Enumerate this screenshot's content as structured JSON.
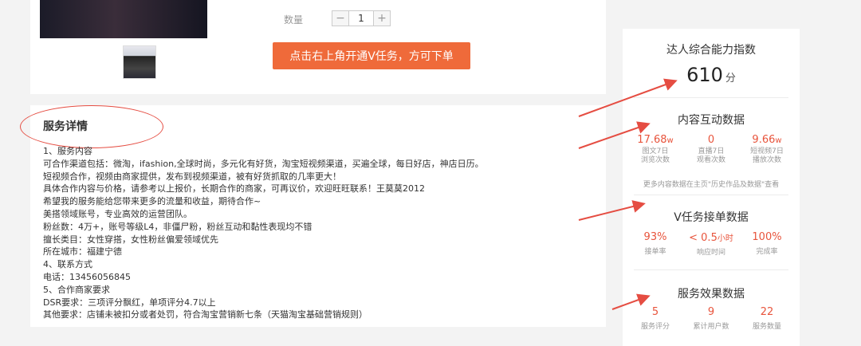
{
  "product": {
    "quantity_label": "数量",
    "quantity_value": "1",
    "minus": "−",
    "plus": "+",
    "cta_label": "点击右上角开通V任务，方可下单"
  },
  "service": {
    "title": "服务详情",
    "lines": [
      "1、服务内容",
      "可合作渠道包括：微淘，ifashion,全球时尚，多元化有好货，淘宝短视频渠道，买遍全球，每日好店，神店日历。",
      "短视频合作，视频由商家提供，发布到视频渠道，被有好货抓取的几率更大！",
      "具体合作内容与价格，请参考以上报价，长期合作的商家，可再议价，欢迎旺旺联系！王莫莫2012",
      "希望我的服务能给您带来更多的流量和收益，期待合作~",
      "美搭领域账号，专业高效的运营团队。",
      "粉丝数：4万+，账号等级L4，非僵尸粉，粉丝互动和黏性表现均不错",
      "擅长类目：女性穿搭，女性粉丝偏爱领域优先",
      "所在城市：福建宁德",
      "4、联系方式",
      "电话：13456056845",
      "5、合作商家要求",
      "DSR要求：三项评分飘红，单项评分4.7以上",
      "其他要求：店铺未被扣分或者处罚，符合淘宝营销新七条（天猫淘宝基础营销规则）"
    ]
  },
  "sidebar": {
    "ability": {
      "title": "达人综合能力指数",
      "score": "610",
      "unit": "分"
    },
    "interaction": {
      "title": "内容互动数据",
      "stats": [
        {
          "value": "17.68",
          "unit": "w",
          "label1": "图文7日",
          "label2": "浏览次数"
        },
        {
          "value": "0",
          "unit": "",
          "label1": "直播7日",
          "label2": "观看次数"
        },
        {
          "value": "9.66",
          "unit": "w",
          "label1": "短视频7日",
          "label2": "播放次数"
        }
      ],
      "note": "更多内容数据在主页\"历史作品及数据\"查看"
    },
    "vtask": {
      "title": "V任务接单数据",
      "stats": [
        {
          "value": "93%",
          "label": "接单率"
        },
        {
          "value": "< 0.5",
          "unit": "小时",
          "label": "响应时间"
        },
        {
          "value": "100%",
          "label": "完成率"
        }
      ]
    },
    "effect": {
      "title": "服务效果数据",
      "stats": [
        {
          "value": "5",
          "label": "服务评分"
        },
        {
          "value": "9",
          "label": "累计用户数"
        },
        {
          "value": "22",
          "label": "服务数量"
        }
      ]
    }
  },
  "colors": {
    "accent": "#ef6a3a",
    "stat_red": "#e8543c",
    "arrow_red": "#e54d42"
  }
}
